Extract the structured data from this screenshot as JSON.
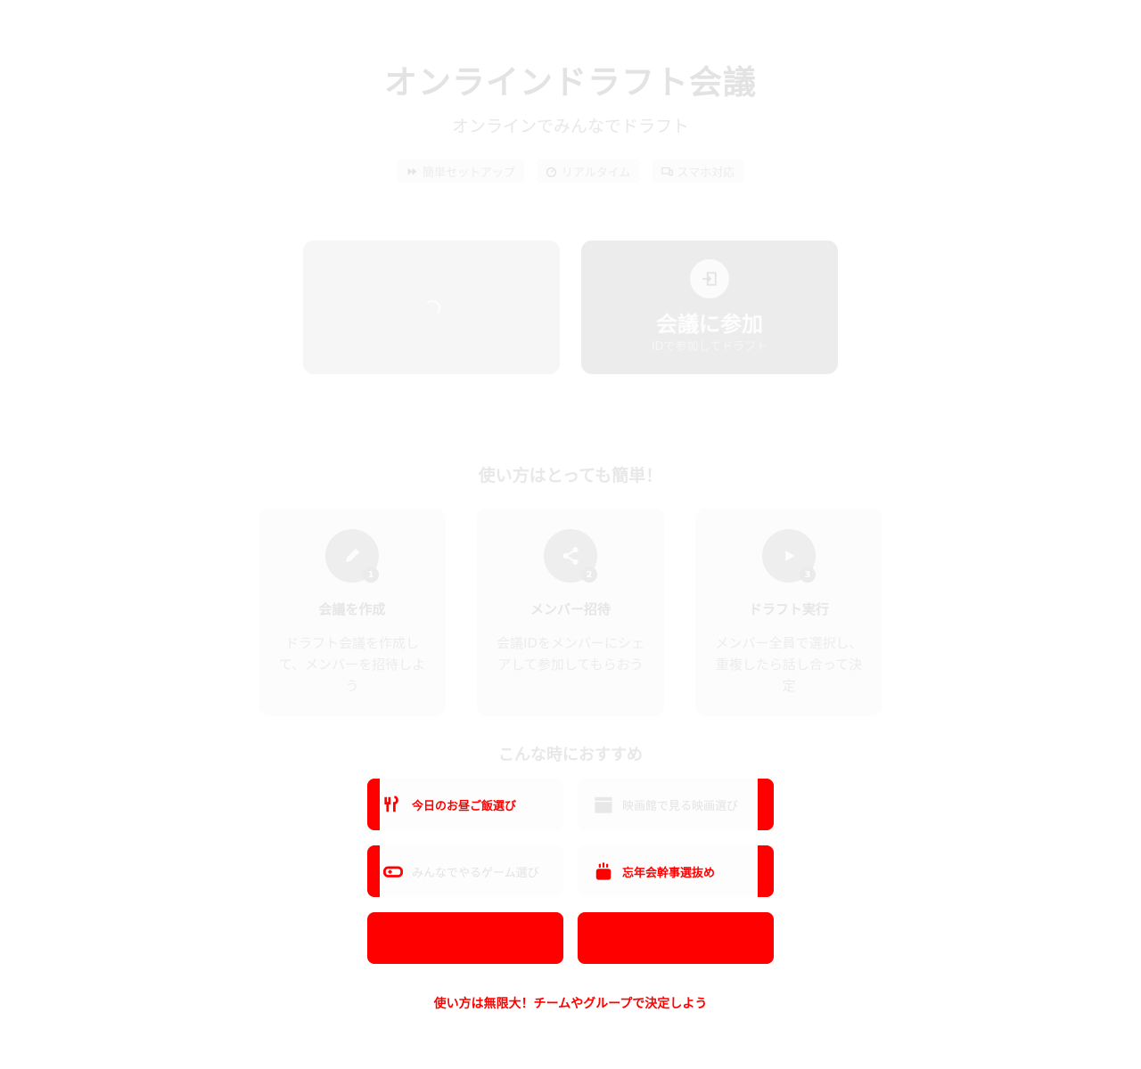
{
  "hero": {
    "title": "オンラインドラフト会議",
    "subtitle": "オンラインでみんなでドラフト",
    "badges": [
      {
        "icon": "fast-forward-icon",
        "label": "簡単セットアップ"
      },
      {
        "icon": "speedometer-icon",
        "label": "リアルタイム"
      },
      {
        "icon": "devices-icon",
        "label": "スマホ対応"
      }
    ]
  },
  "actions": {
    "join": {
      "title": "会議に参加",
      "subtitle": "IDで参加してドラフト",
      "icon": "login-icon"
    }
  },
  "steps": {
    "heading": "使い方はとっても簡単！",
    "items": [
      {
        "number": "1",
        "icon": "pencil-icon",
        "title": "会議を作成",
        "description": "ドラフト会議を作成して、メンバーを招待しよう"
      },
      {
        "number": "2",
        "icon": "share-icon",
        "title": "メンバー招待",
        "description": "会議IDをメンバーにシェアして参加してもらおう"
      },
      {
        "number": "3",
        "icon": "play-icon",
        "title": "ドラフト実行",
        "description": "メンバー全員で選択し、重複したら話し合って決定"
      }
    ]
  },
  "recommend": {
    "heading": "こんな時におすすめ",
    "items": [
      {
        "icon": "food-icon",
        "label": "今日のお昼ご飯選び"
      },
      {
        "icon": "clapperboard-icon",
        "label": "映画館で見る映画選び"
      },
      {
        "icon": "gamepad-icon",
        "label": "みんなでやるゲーム選び"
      },
      {
        "icon": "cake-icon",
        "label": "忘年会幹事選抜め"
      }
    ],
    "footer": "使い方は無限大！チームやグループで決定しよう"
  },
  "colors": {
    "accent": "#ff0000",
    "faint_text": "#e6e6e6",
    "card_bg": "#f6f6f6"
  }
}
